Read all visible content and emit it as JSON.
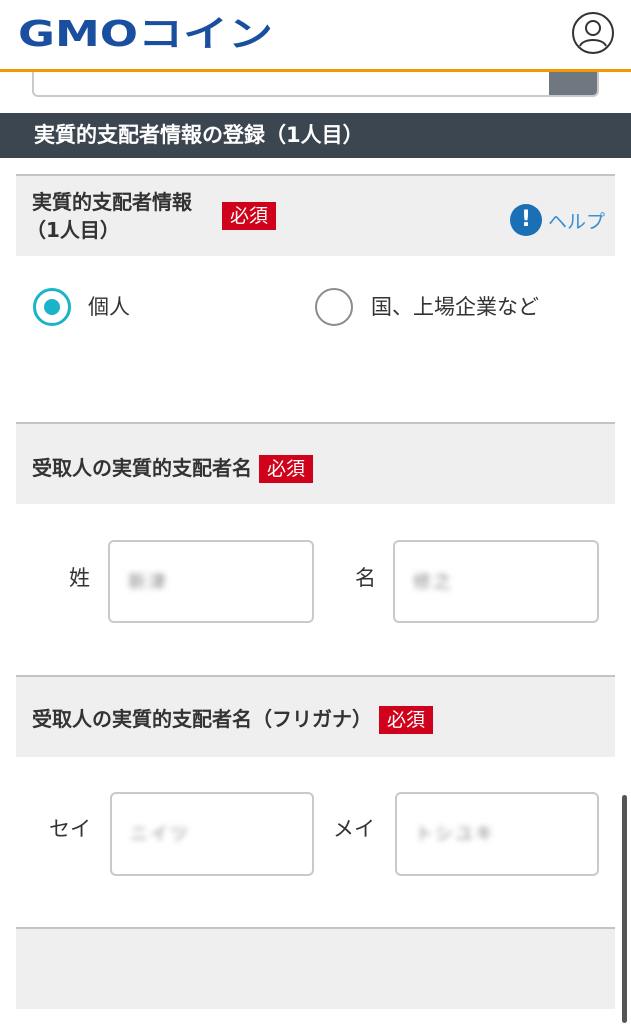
{
  "header": {
    "logo_text": "GMOコイン",
    "brand_color": "#1a4fa0",
    "accent_color": "#f39800",
    "avatar_icon": "user-circle-icon"
  },
  "section": {
    "title": "実質的支配者情報の登録（1人目）"
  },
  "questions": {
    "owner_type": {
      "title_line1": "実質的支配者情報",
      "title_line2": "（1人目）",
      "required": "必須",
      "help_icon": "exclamation-circle-icon",
      "help_label": "ヘルプ",
      "options": [
        {
          "label": "個人",
          "selected": true
        },
        {
          "label": "国、上場企業など",
          "selected": false
        }
      ]
    },
    "name": {
      "title": "受取人の実質的支配者名",
      "required": "必須",
      "last_label": "姓",
      "last_value": "新津",
      "first_label": "名",
      "first_value": "修之"
    },
    "kana": {
      "title": "受取人の実質的支配者名（フリガナ）",
      "required": "必須",
      "last_label": "セイ",
      "last_value": "ニイツ",
      "first_label": "メイ",
      "first_value": "トシユキ"
    }
  }
}
